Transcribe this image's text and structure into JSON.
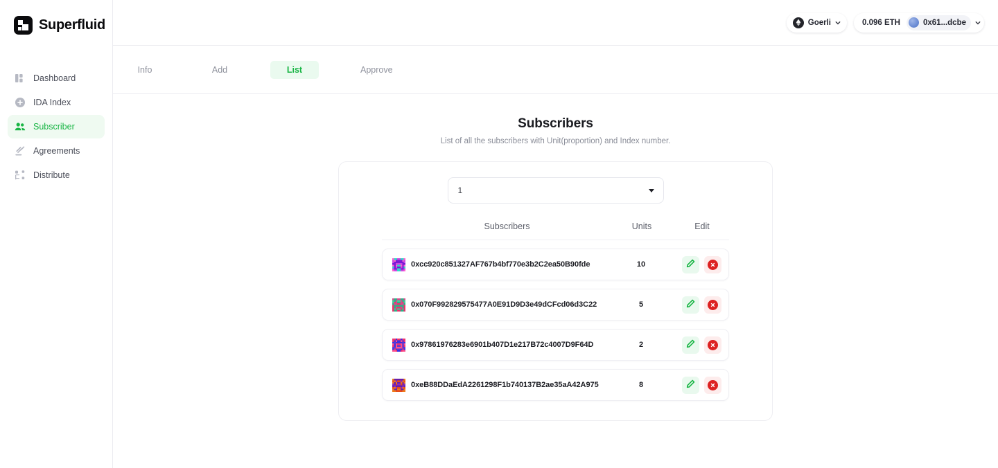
{
  "brand": {
    "name": "Superfluid",
    "logo_icon": "superfluid-logo-icon"
  },
  "sidebar": {
    "items": [
      {
        "label": "Dashboard",
        "icon": "dashboard-icon",
        "active": false
      },
      {
        "label": "IDA Index",
        "icon": "plus-circle-icon",
        "active": false
      },
      {
        "label": "Subscriber",
        "icon": "people-icon",
        "active": true
      },
      {
        "label": "Agreements",
        "icon": "gavel-icon",
        "active": false
      },
      {
        "label": "Distribute",
        "icon": "sitemap-icon",
        "active": false
      }
    ]
  },
  "topbar": {
    "network": {
      "label": "Goerli",
      "icon": "ethereum-icon",
      "chevron": "chevron-down-icon"
    },
    "balance": "0.096 ETH",
    "account": {
      "address_short": "0x61...dcbe",
      "avatar": "account-avatar",
      "chevron": "chevron-down-icon"
    }
  },
  "tabs": [
    {
      "label": "Info",
      "active": false
    },
    {
      "label": "Add",
      "active": false
    },
    {
      "label": "List",
      "active": true
    },
    {
      "label": "Approve",
      "active": false
    }
  ],
  "page": {
    "title": "Subscribers",
    "subtitle": "List of all the subscribers with Unit(proportion) and Index number."
  },
  "index_select": {
    "value": "1",
    "options": [
      "1"
    ],
    "caret": "caret-down-icon"
  },
  "table": {
    "headers": {
      "subscribers": "Subscribers",
      "units": "Units",
      "edit": "Edit"
    },
    "rows": [
      {
        "address": "0xcc920c851327AF767b4bf770e3b2C2ea50B90fde",
        "units": "10",
        "blockie_colors": [
          "#c94be0",
          "#7a18d6",
          "#ff5fd0",
          "#2fd8c8"
        ],
        "edit_icon": "pencil-icon",
        "delete_icon": "delete-circle-icon"
      },
      {
        "address": "0x070F992829575477A0E91D9D3e49dCFcd06d3C22",
        "units": "5",
        "blockie_colors": [
          "#e8356d",
          "#2fb089",
          "#d84a8c",
          "#49c79a"
        ],
        "edit_icon": "pencil-icon",
        "delete_icon": "delete-circle-icon"
      },
      {
        "address": "0x97861976283e6901b407D1e217B72c4007D9F64D",
        "units": "2",
        "blockie_colors": [
          "#f0336f",
          "#3b2fe0",
          "#ff4f8b",
          "#5a3ad6"
        ],
        "edit_icon": "pencil-icon",
        "delete_icon": "delete-circle-icon"
      },
      {
        "address": "0xeB88DDaEdA2261298F1b740137B2ae35aA42A975",
        "units": "8",
        "blockie_colors": [
          "#f07a18",
          "#6b1fa8",
          "#e84a1a",
          "#8a2fc0"
        ],
        "edit_icon": "pencil-icon",
        "delete_icon": "delete-circle-icon"
      }
    ]
  },
  "colors": {
    "accent_green": "#18b544",
    "danger_red": "#dd2222",
    "border": "#ececf0"
  }
}
